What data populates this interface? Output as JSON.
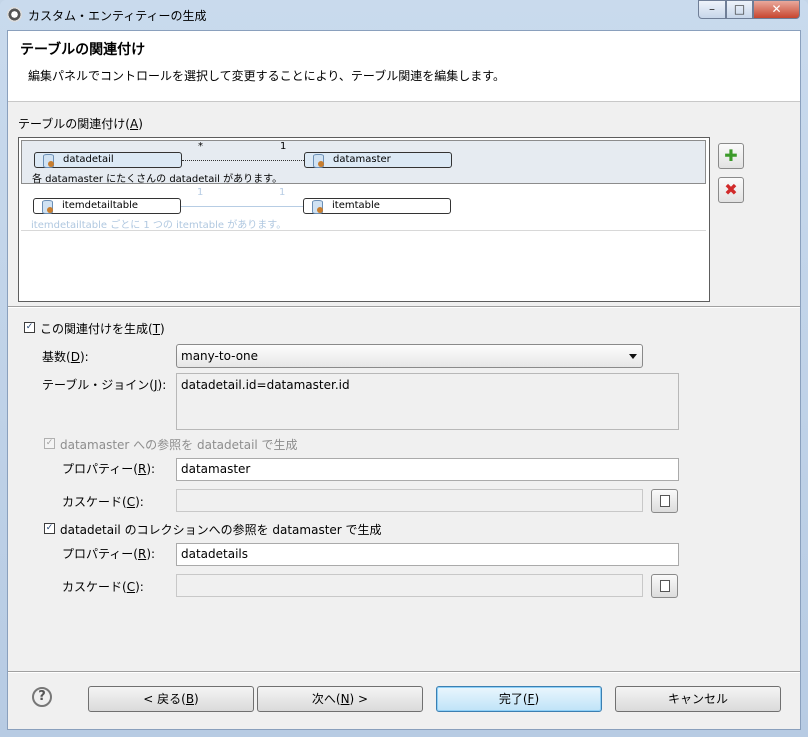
{
  "window": {
    "title": "カスタム・エンティティーの生成",
    "controls": {
      "minimize": "–",
      "maximize": "□",
      "close": "✕"
    }
  },
  "banner": {
    "title": "テーブルの関連付け",
    "description": "編集パネルでコントロールを選択して変更することにより、テーブル関連を編集します。"
  },
  "associations": {
    "label": "テーブルの関連付け(",
    "mnemonic": "A",
    "label_end": ")",
    "rows": [
      {
        "left": "datadetail",
        "right": "datamaster",
        "left_mult": "*",
        "right_mult": "1",
        "text": "各 datamaster にたくさんの datadetail があります。"
      },
      {
        "left": "itemdetailtable",
        "right": "itemtable",
        "left_mult": "1",
        "right_mult": "1",
        "text": "itemdetailtable ごとに 1 つの itemtable があります。"
      }
    ]
  },
  "generate": {
    "checked": "✓",
    "label": "この関連付けを生成(",
    "mnemonic": "T",
    "end": ")"
  },
  "cardinality": {
    "label": "基数(",
    "mnemonic": "D",
    "end": "):",
    "value": "many-to-one"
  },
  "join": {
    "label": "テーブル・ジョイン(",
    "mnemonic": "J",
    "end": "):",
    "value": "datadetail.id=datamaster.id"
  },
  "ref1": {
    "checked": "✓",
    "label": "datamaster への参照を datadetail で生成",
    "prop_label": "プロパティー(",
    "prop_mn": "R",
    "prop_end": "):",
    "prop_value": "datamaster",
    "cascade_label": "カスケード(",
    "cascade_mn": "C",
    "cascade_end": "):",
    "cascade_value": ""
  },
  "ref2": {
    "checked": "✓",
    "label": "datadetail のコレクションへの参照を datamaster で生成",
    "prop_label": "プロパティー(",
    "prop_mn": "R",
    "prop_end": "):",
    "prop_value": "datadetails",
    "cascade_label": "カスケード(",
    "cascade_mn": "C",
    "cascade_end": "):",
    "cascade_value": ""
  },
  "buttons": {
    "help": "?",
    "back": {
      "pre": "< 戻る(",
      "mn": "B",
      "post": ")"
    },
    "next": {
      "pre": "次へ(",
      "mn": "N",
      "post": ") >"
    },
    "finish": {
      "pre": "完了(",
      "mn": "F",
      "post": ")"
    },
    "cancel": "キャンセル"
  },
  "icons": [
    "app-icon",
    "database-icon",
    "add-icon",
    "delete-icon",
    "browse-icon",
    "help-icon"
  ],
  "colors": {
    "selected_row": "#e6ebf1",
    "entity_fill": "#dce9f5",
    "add_green": "#3c9a2a",
    "delete_red": "#d12a2a",
    "default_button": "#bfe3f8"
  }
}
